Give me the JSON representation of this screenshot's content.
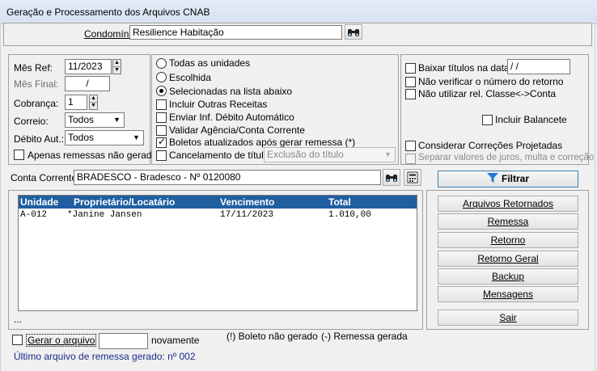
{
  "window": {
    "title": "Geração e Processamento dos Arquivos CNAB"
  },
  "condominio": {
    "label": "Condomínio:",
    "value": "Resilience Habitação"
  },
  "left": {
    "mes_ref_label": "Mês Ref:",
    "mes_ref_value": "11/2023",
    "mes_final_label": "Mês Final:",
    "mes_final_value": "/",
    "cobranca_label": "Cobrança:",
    "cobranca_value": "1",
    "correio_label": "Correio:",
    "correio_value": "Todos",
    "debito_label": "Débito Aut.:",
    "debito_value": "Todos",
    "apenas_label": "Apenas remessas não geradas"
  },
  "middle": {
    "todas_label": "Todas as unidades",
    "escolhida_label": "Escolhida",
    "selecionadas_label": "Selecionadas na lista abaixo",
    "incluir_label": "Incluir Outras Receitas",
    "enviar_label": "Enviar Inf. Débito Automático",
    "validar_label": "Validar Agência/Conta Corrente",
    "boletos_label": "Boletos atualizados após gerar remessa (*)",
    "cancelamento_label": "Cancelamento de título",
    "cancelamento_value": "Exclusão do título"
  },
  "right": {
    "baixar_label": "Baixar títulos na data:",
    "baixar_value": "/ /",
    "nao_verificar_label": "Não verificar o número do retorno",
    "nao_utilizar_label": "Não utilizar rel. Classe<->Conta",
    "incluir_balancete_label": "Incluir Balancete",
    "considerar_label": "Considerar Correções Projetadas",
    "separar_label": "Separar valores de juros, multa e correção"
  },
  "conta": {
    "label": "Conta Corrente:",
    "value": "BRADESCO - Bradesco - Nº 0120080"
  },
  "filtrar_label": "Filtrar",
  "table": {
    "headers": [
      "Unidade",
      "Proprietário/Locatário",
      "Vencimento",
      "Total"
    ],
    "rows": [
      [
        "A-012",
        "*Janine Jansen",
        "17/11/2023",
        "1.010,00"
      ]
    ],
    "more": "..."
  },
  "buttons": {
    "arquivos_retornados": "Arquivos Retornados",
    "remessa": "Remessa",
    "retorno": "Retorno",
    "retorno_geral": "Retorno Geral",
    "backup": "Backup",
    "mensagens": "Mensagens",
    "sair": "Sair"
  },
  "footer": {
    "gerar_label": "Gerar o arquivo",
    "gerar_value": "",
    "novamente_label": "novamente",
    "legend1": "(!) Boleto não gerado",
    "legend2": "(-) Remessa gerada",
    "ultimo": "Último arquivo de remessa gerado: nº 002"
  },
  "colors": {
    "header_bg": "#1f5fa0",
    "footer_text": "#1a2a8a"
  },
  "icons": [
    "binoculars-icon",
    "calculator-icon",
    "filter-icon"
  ]
}
